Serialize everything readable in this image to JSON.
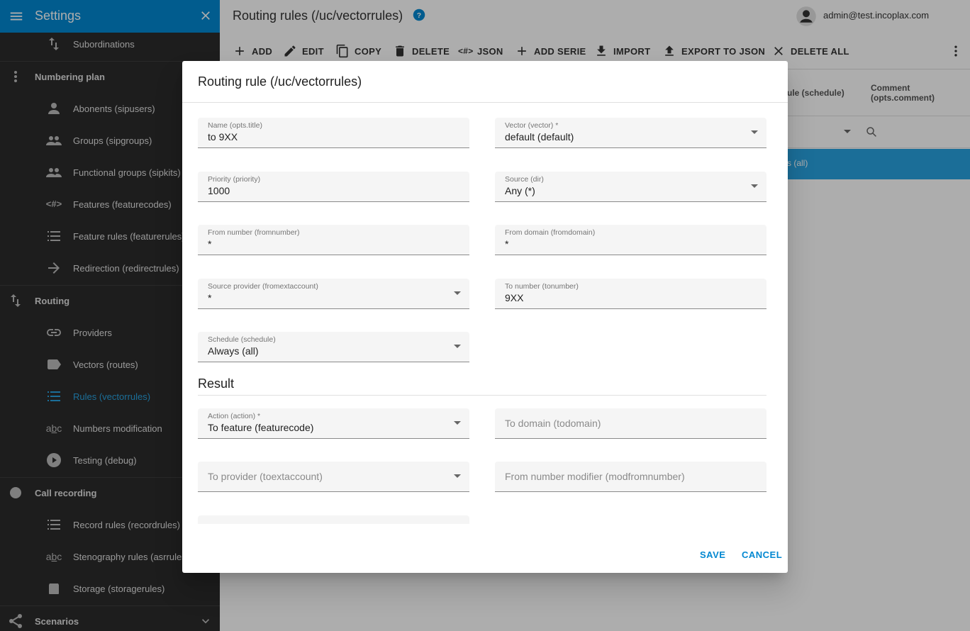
{
  "sidebar": {
    "title": "Settings",
    "items": [
      {
        "label": "Subordinations",
        "icon": "sort-arrows-icon"
      },
      {
        "label": "Numbering plan",
        "icon": "vertical-dots-icon",
        "group": true
      },
      {
        "label": "Abonents (sipusers)",
        "icon": "person-icon"
      },
      {
        "label": "Groups (sipgroups)",
        "icon": "people-icon"
      },
      {
        "label": "Functional groups (sipkits)",
        "icon": "people-icon"
      },
      {
        "label": "Features (featurecodes)",
        "icon": "code-hash-icon"
      },
      {
        "label": "Feature rules (featurerules)",
        "icon": "list-icon"
      },
      {
        "label": "Redirection (redirectrules)",
        "icon": "arrow-right-icon"
      },
      {
        "label": "Routing",
        "icon": "sort-arrows-icon",
        "group": true
      },
      {
        "label": "Providers",
        "icon": "link-icon"
      },
      {
        "label": "Vectors (routes)",
        "icon": "label-icon"
      },
      {
        "label": "Rules (vectorrules)",
        "icon": "list-icon",
        "active": true
      },
      {
        "label": "Numbers modification",
        "icon": "abc-icon"
      },
      {
        "label": "Testing (debug)",
        "icon": "play-circle-icon"
      },
      {
        "label": "Call recording",
        "icon": "record-circle-icon",
        "group": true
      },
      {
        "label": "Record rules (recordrules)",
        "icon": "list-icon"
      },
      {
        "label": "Stenography rules (asrrules)",
        "icon": "abc-icon"
      },
      {
        "label": "Storage (storagerules)",
        "icon": "storage-icon"
      },
      {
        "label": "Scenarios",
        "icon": "share-icon",
        "group": true
      }
    ]
  },
  "header": {
    "title": "Routing rules (/uc/vectorrules)",
    "user": "admin@test.incoplax.com"
  },
  "toolbar": {
    "buttons": [
      {
        "label": "ADD",
        "icon": "plus-icon"
      },
      {
        "label": "EDIT",
        "icon": "pencil-icon"
      },
      {
        "label": "COPY",
        "icon": "copy-icon"
      },
      {
        "label": "DELETE",
        "icon": "trash-icon"
      },
      {
        "label": "JSON",
        "icon": "code-hash-icon"
      },
      {
        "label": "ADD SERIE",
        "icon": "plus-icon"
      },
      {
        "label": "IMPORT",
        "icon": "download-icon"
      },
      {
        "label": "EXPORT TO JSON",
        "icon": "upload-icon"
      },
      {
        "label": "DELETE ALL",
        "icon": "close-icon"
      }
    ]
  },
  "table": {
    "col_schedule": "ule (schedule)",
    "col_comment_1": "Comment",
    "col_comment_2": "(opts.comment)",
    "selected_row_text": "s (all)"
  },
  "dialog": {
    "title": "Routing rule (/uc/vectorrules)",
    "fields": {
      "name": {
        "label": "Name (opts.title)",
        "value": "to 9XX"
      },
      "vector": {
        "label": "Vector (vector) *",
        "value": "default (default)"
      },
      "priority": {
        "label": "Priority (priority)",
        "value": "1000"
      },
      "source": {
        "label": "Source (dir)",
        "value": "Any (*)"
      },
      "from_number": {
        "label": "From number (fromnumber)",
        "value": "*"
      },
      "from_domain": {
        "label": "From domain (fromdomain)",
        "value": "*"
      },
      "source_provider": {
        "label": "Source provider (fromextaccount)",
        "value": "*"
      },
      "to_number": {
        "label": "To number (tonumber)",
        "value": "9XX"
      },
      "schedule": {
        "label": "Schedule (schedule)",
        "value": "Always (all)"
      },
      "action": {
        "label": "Action (action) *",
        "value": "To feature (featurecode)"
      },
      "to_domain": {
        "placeholder": "To domain (todomain)"
      },
      "to_provider": {
        "placeholder": "To provider (toextaccount)"
      },
      "from_modifier": {
        "placeholder": "From number modifier (modfromnumber)"
      }
    },
    "section_result": "Result",
    "save": "SAVE",
    "cancel": "CANCEL"
  },
  "colors": {
    "accent": "#0288d1",
    "sidebar_bg": "#2b2b2b",
    "active_item": "#29a3e0"
  }
}
